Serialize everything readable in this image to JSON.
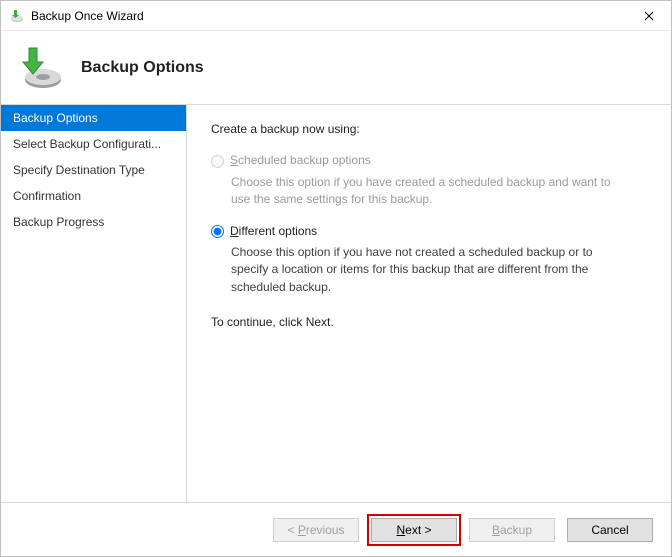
{
  "window": {
    "title": "Backup Once Wizard"
  },
  "header": {
    "title": "Backup Options"
  },
  "sidebar": {
    "steps": [
      {
        "label": "Backup Options",
        "selected": true
      },
      {
        "label": "Select Backup Configurati...",
        "selected": false
      },
      {
        "label": "Specify Destination Type",
        "selected": false
      },
      {
        "label": "Confirmation",
        "selected": false
      },
      {
        "label": "Backup Progress",
        "selected": false
      }
    ]
  },
  "content": {
    "prompt": "Create a backup now using:",
    "options": [
      {
        "id": "scheduled",
        "access_key": "S",
        "label_rest": "cheduled backup options",
        "description": "Choose this option if you have created a scheduled backup and want to use the same settings for this backup.",
        "enabled": false,
        "selected": false
      },
      {
        "id": "different",
        "access_key": "D",
        "label_rest": "ifferent options",
        "description": "Choose this option if you have not created a scheduled backup or to specify a location or items for this backup that are different from the scheduled backup.",
        "enabled": true,
        "selected": true
      }
    ],
    "continue_hint": "To continue, click Next."
  },
  "footer": {
    "previous": {
      "label_prefix": "< ",
      "access_key": "P",
      "label_rest": "revious",
      "enabled": false
    },
    "next": {
      "access_key": "N",
      "label_rest": "ext >",
      "enabled": true,
      "highlighted": true
    },
    "backup": {
      "access_key": "B",
      "label_rest": "ackup",
      "enabled": false
    },
    "cancel": {
      "label": "Cancel",
      "enabled": true
    }
  }
}
